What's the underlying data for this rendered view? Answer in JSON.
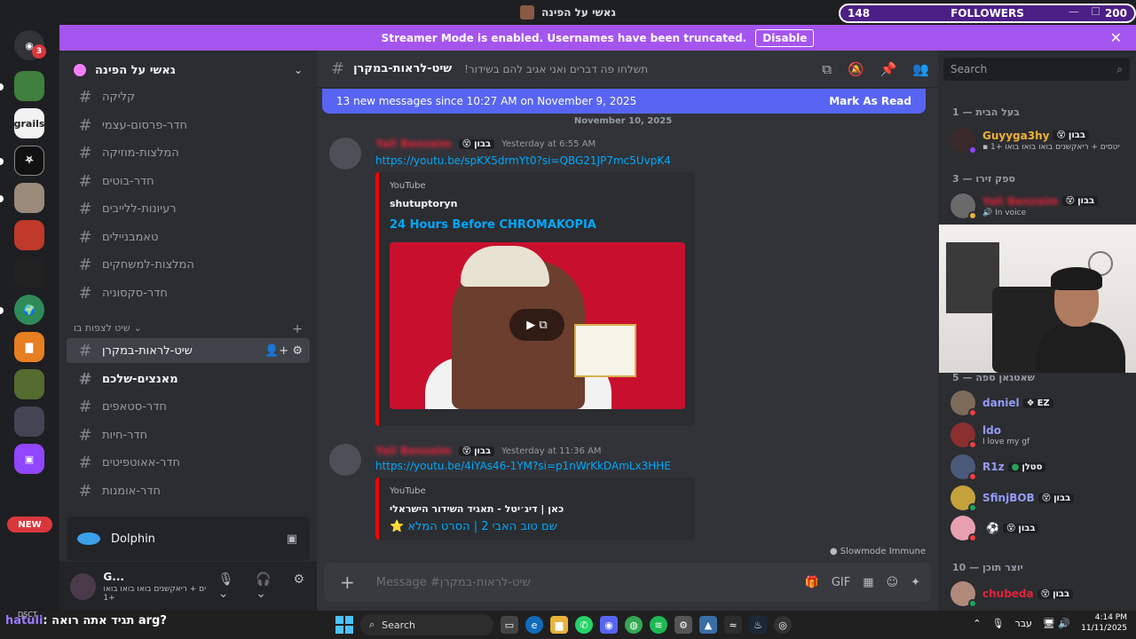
{
  "window": {
    "title": "גאשי על הפינה"
  },
  "overlay": {
    "followers_current": "148",
    "followers_label": "FOLLOWERS",
    "followers_goal": "200",
    "minimize": "—",
    "maximize": "☐"
  },
  "banner": {
    "text": "Streamer Mode is enabled. Usernames have been truncated.",
    "disable": "Disable",
    "close": "✕"
  },
  "rail": {
    "badge_count": "3",
    "new_label": "NEW"
  },
  "guild": {
    "name": "גאשי על הפינה"
  },
  "channels": [
    {
      "name": "קליקה"
    },
    {
      "name": "חדר-פרסום-עצמי"
    },
    {
      "name": "המלצות-מוזיקה"
    },
    {
      "name": "חדר-בוטים"
    },
    {
      "name": "רעיונות-ללייבים"
    },
    {
      "name": "טאמבניילים"
    },
    {
      "name": "המלצות-למשחקים"
    },
    {
      "name": "חדר-סקסוניה"
    }
  ],
  "category": {
    "name": "שיט לצפות בו"
  },
  "channels2": [
    {
      "name": "שיט-לראות-במקרן"
    },
    {
      "name": "מאנצים-שלכם"
    },
    {
      "name": "חדר-סטאפים"
    },
    {
      "name": "חדר-חיות"
    },
    {
      "name": "חדר-אאוטפיטים"
    },
    {
      "name": "חדר-אומנות"
    }
  ],
  "activity": {
    "name": "Dolphin"
  },
  "user": {
    "name": "G...",
    "status": "ים + ריאקשנים בואו בואו בואו",
    "extra": "+1"
  },
  "header": {
    "channel": "שיט-לראות-במקרן",
    "topic": "!תשלחו פה דברים ואני אגיב להם בשידור"
  },
  "newbar": {
    "text": "13 new messages since 10:27 AM on November 9, 2025",
    "mark": "Mark As Read"
  },
  "date": "November 10, 2025",
  "messages": [
    {
      "author": "Yali Benzaim",
      "tag": "בבון",
      "time": "Yesterday at 6:55 AM",
      "link": "https://youtu.be/spKX5drmYt0?si=QBG21JP7mc5UvpK4",
      "provider": "YouTube",
      "embed_author": "shutuptoryn",
      "embed_title": "24 Hours Before CHROMAKOPIA"
    },
    {
      "author": "Yali Benzaim",
      "tag": "בבון",
      "time": "Yesterday at 11:36 AM",
      "link": "https://youtu.be/4iYAs46-1YM?si=p1nWrKkDAmLx3HHE",
      "provider": "YouTube",
      "embed_author": "כאן | דיג׳יטל - תאגיד השידור הישראלי",
      "embed_title": "שם טוב האבי 2 | הסרט המלא"
    }
  ],
  "slowmode": "Slowmode Immune",
  "composer": {
    "placeholder": "Message #שיט-לראות-במקרן"
  },
  "members": {
    "search": "Search",
    "groups": [
      {
        "label": "בעל הבית — 1"
      },
      {
        "label": "ספק זירו — 3"
      },
      {
        "label": "שאטגאן ספה — 5"
      },
      {
        "label": "יוצר תוכן — 10"
      }
    ],
    "list": [
      {
        "name": "Guyyga3hy",
        "tag": "בבון",
        "sub": "יטסים + ריאקשנים בואו בואו בואו",
        "extra": "+1"
      },
      {
        "name": "Yali Benzaim",
        "tag": "בבון",
        "sub": "In voice"
      },
      {
        "name": "daniel",
        "tag": "EZ",
        "sub": ""
      },
      {
        "name": "ldo",
        "tag": "",
        "sub": "I love my gf"
      },
      {
        "name": "R1z",
        "tag": "סטלן",
        "sub": ""
      },
      {
        "name": "SfinjBOB",
        "tag": "בבון",
        "sub": ""
      },
      {
        "name": "",
        "tag": "בבון",
        "sub": ""
      },
      {
        "name": "chubeda",
        "tag": "בבון",
        "sub": ""
      }
    ]
  },
  "taskbar": {
    "stream_user": "hatuli",
    "stream_msg": "תגיד אתה רואה arg?",
    "dsct": "DSCT",
    "search": "Search",
    "lang": "עבר",
    "time": "4:14 PM",
    "date": "11/11/2025"
  }
}
